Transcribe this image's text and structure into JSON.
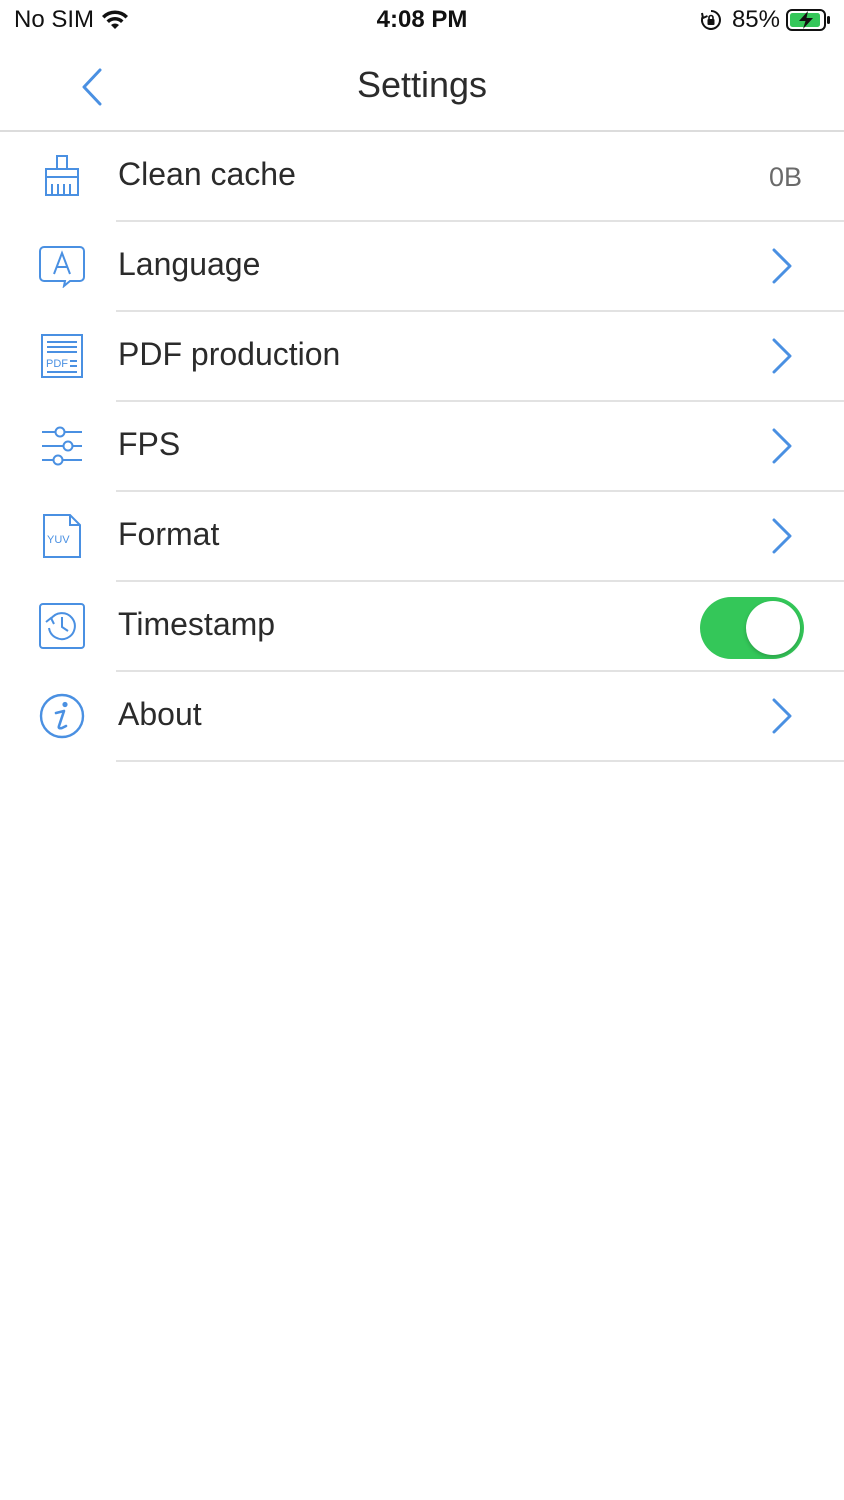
{
  "status_bar": {
    "carrier": "No SIM",
    "time": "4:08 PM",
    "battery": "85%"
  },
  "nav": {
    "title": "Settings",
    "back_icon": "chevron-left-icon"
  },
  "colors": {
    "accent": "#4a90e2",
    "toggle_on": "#34c759",
    "separator": "#e2e2e2"
  },
  "settings": {
    "items": [
      {
        "label": "Clean cache",
        "value": "0B",
        "icon": "broom-icon"
      },
      {
        "label": "Language",
        "icon": "language-icon"
      },
      {
        "label": "PDF production",
        "icon": "pdf-icon"
      },
      {
        "label": "FPS",
        "icon": "sliders-icon"
      },
      {
        "label": "Format",
        "icon": "yuv-file-icon"
      },
      {
        "label": "Timestamp",
        "icon": "history-icon",
        "toggle_on": true
      },
      {
        "label": "About",
        "icon": "info-icon"
      }
    ]
  }
}
